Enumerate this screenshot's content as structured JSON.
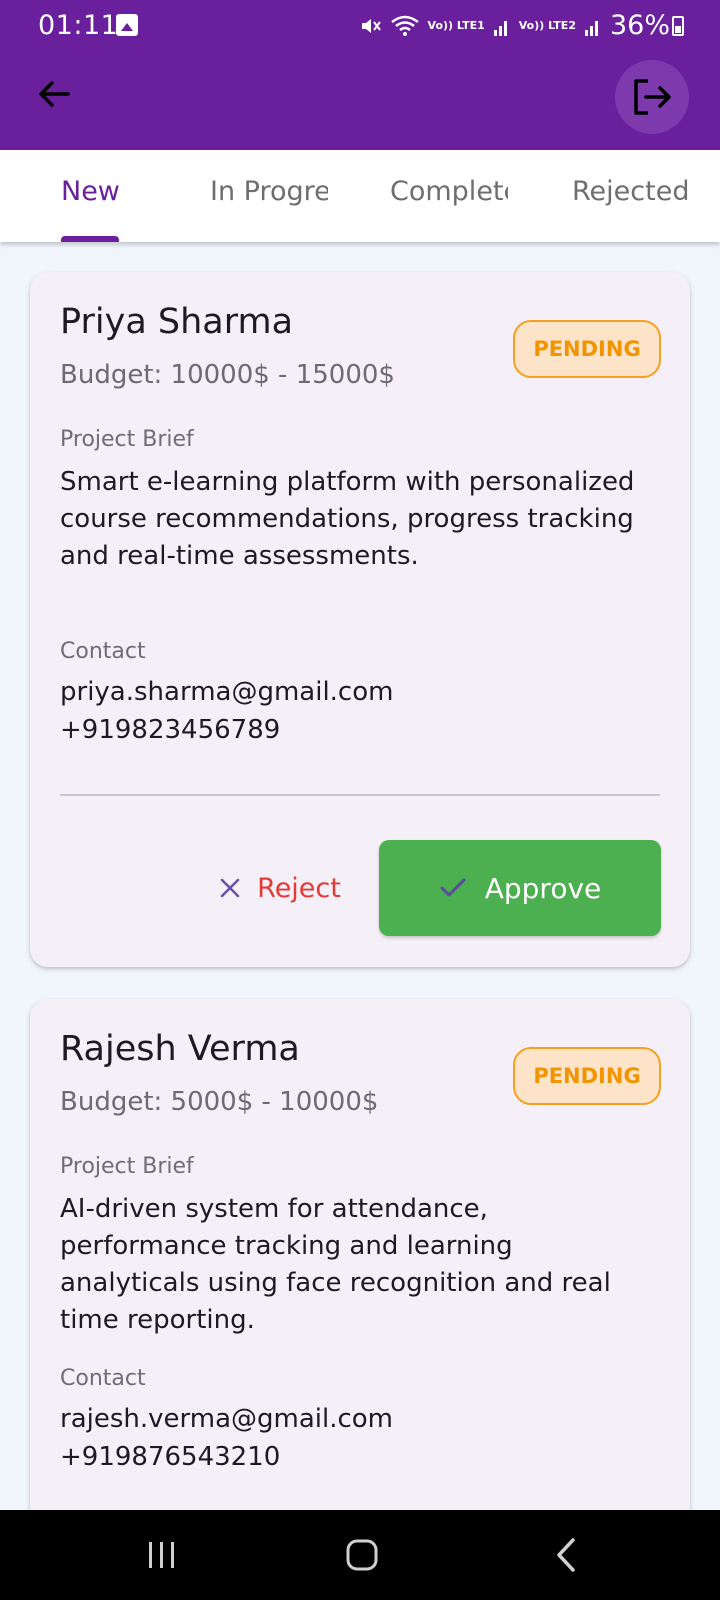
{
  "status_bar": {
    "time": "01:11",
    "signal_1": "Vo)) LTE1",
    "signal_2": "Vo)) LTE2",
    "battery": "36%"
  },
  "app_bar": {
    "back_icon": "arrow-left-icon",
    "logout_icon": "logout-icon"
  },
  "tabs": [
    {
      "label": "New",
      "active": true
    },
    {
      "label": "In Progress",
      "active": false
    },
    {
      "label": "Completed",
      "active": false
    },
    {
      "label": "Rejected",
      "active": false
    }
  ],
  "cards": [
    {
      "name": "Priya Sharma",
      "budget": "Budget: 10000$ - 15000$",
      "status": "PENDING",
      "brief_label": "Project Brief",
      "brief": "Smart e-learning platform with personalized course recommendations, progress tracking and real-time assessments.",
      "contact_label": "Contact",
      "email": "priya.sharma@gmail.com",
      "phone": "+919823456789",
      "reject_label": "Reject",
      "approve_label": "Approve"
    },
    {
      "name": "Rajesh Verma",
      "budget": "Budget: 5000$ - 10000$",
      "status": "PENDING",
      "brief_label": "Project Brief",
      "brief": "AI-driven system for attendance, performance tracking and learning analyticals using face recognition and real time reporting.",
      "contact_label": "Contact",
      "email": "rajesh.verma@gmail.com",
      "phone": "+919876543210"
    }
  ],
  "colors": {
    "primary": "#6a1f9c",
    "approve": "#4caf50",
    "reject": "#e53935",
    "pending": "#f29400"
  }
}
